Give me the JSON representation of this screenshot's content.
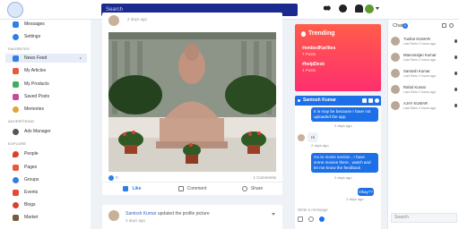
{
  "header": {
    "search_placeholder": "Search"
  },
  "sidebar": {
    "top_items": [
      {
        "label": "Messages",
        "color": "#2e7fe6"
      },
      {
        "label": "Settings",
        "color": "#2e7fe6"
      }
    ],
    "favorites_heading": "FAVORITES",
    "favorites": [
      {
        "label": "News Feed",
        "color": "#2e7fe6",
        "active": true
      },
      {
        "label": "My Articles",
        "color": "#e35a3e"
      },
      {
        "label": "My Products",
        "color": "#3fae5a"
      },
      {
        "label": "Saved Posts",
        "color": "#c64b9a"
      },
      {
        "label": "Memories",
        "color": "#e2a33a"
      }
    ],
    "advertising_heading": "ADVERTISING",
    "advertising": [
      {
        "label": "Ads Manager",
        "color": "#555555"
      }
    ],
    "explore_heading": "EXPLORE",
    "explore": [
      {
        "label": "People",
        "color": "#d9412c"
      },
      {
        "label": "Pages",
        "color": "#e35a3e"
      },
      {
        "label": "Groups",
        "color": "#2e7fe6"
      },
      {
        "label": "Events",
        "color": "#e2483c"
      },
      {
        "label": "Blogs",
        "color": "#d9412c"
      },
      {
        "label": "Market",
        "color": "#7a5a3c"
      }
    ]
  },
  "post": {
    "time": "2 days ago",
    "like_count": "0",
    "comments": "1 Comments",
    "actions": {
      "like": "Like",
      "comment": "Comment",
      "share": "Share"
    }
  },
  "post2": {
    "author": "Santosh Kumar",
    "action": "updated the profile picture",
    "time": "3 days ago"
  },
  "trending": {
    "title": "Trending",
    "tags": [
      {
        "tag": "#embedKarlites",
        "count": "7 Posts"
      },
      {
        "tag": "#helpDesk",
        "count": "1 Posts"
      }
    ]
  },
  "chat_window": {
    "name": "Santosh Kumar",
    "messages": [
      {
        "from": "me",
        "text": "It is may be because I have not uploaded the app",
        "time": "2 days ago"
      },
      {
        "from": "them",
        "text": "Hi",
        "time": "2 days ago"
      },
      {
        "from": "me",
        "text": "Go to movie section , I have some movies there , watch and let me know the feedback",
        "time": "2 days ago"
      },
      {
        "from": "me",
        "text": "Okay??",
        "time": "2 days ago"
      }
    ],
    "input_placeholder": "Write a message"
  },
  "chat_list": {
    "title": "Chat",
    "badge": "5",
    "contacts": [
      {
        "name": "Tushar KUMAR",
        "seen": "Last Seen 2 hours ago"
      },
      {
        "name": "Manoranjan Kumar",
        "seen": "Last Seen 2 hours ago"
      },
      {
        "name": "Santosh Kumar",
        "seen": "Last Seen 2 hours ago"
      },
      {
        "name": "Rahul Kumar",
        "seen": "Last Seen 2 hours ago"
      },
      {
        "name": "AJAY KUMAR",
        "seen": "Last Seen 2 hours ago"
      }
    ],
    "search_placeholder": "Search"
  }
}
